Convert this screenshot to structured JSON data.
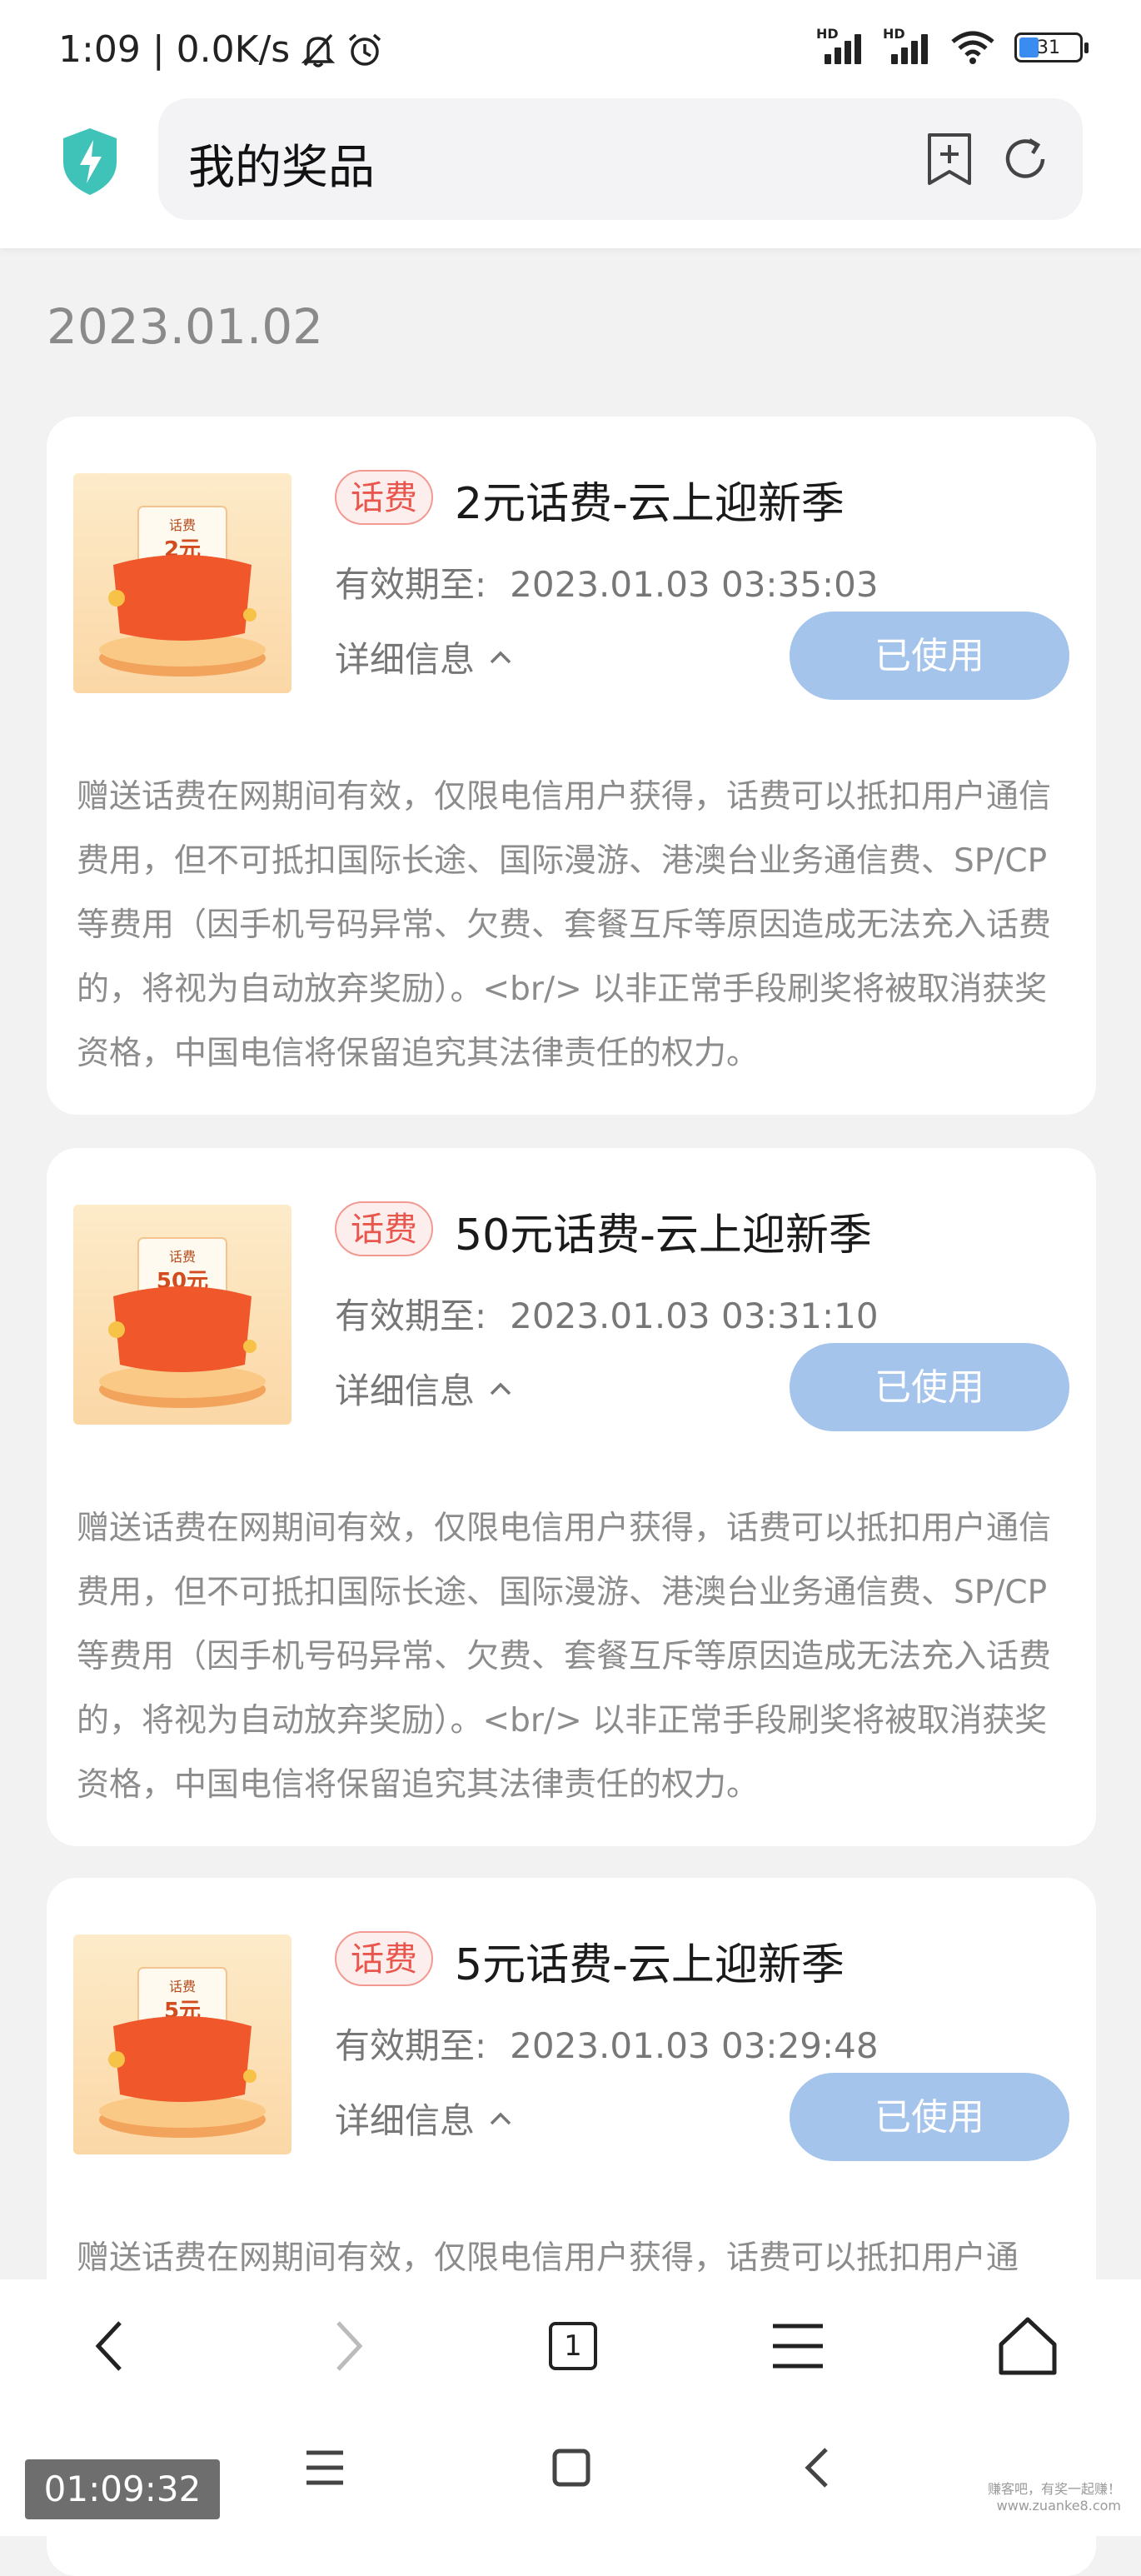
{
  "status_bar": {
    "time": "1:09",
    "net_speed": "0.0K/s",
    "sim_label": "HD",
    "battery": "31"
  },
  "browser": {
    "title": "我的奖品"
  },
  "date_group": "2023.01.02",
  "prizes": [
    {
      "tag": "话费",
      "name": "2元话费-云上迎新季",
      "expire_label": "有效期至:",
      "expire_value": "2023.01.03 03:35:03",
      "detail_label": "详细信息",
      "status": "已使用",
      "thumb_text": "话费",
      "thumb_amount": "2元",
      "description": "赠送话费在网期间有效，仅限电信用户获得，话费可以抵扣用户通信费用，但不可抵扣国际长途、国际漫游、港澳台业务通信费、SP/CP等费用（因手机号码异常、欠费、套餐互斥等原因造成无法充入话费的，将视为自动放弃奖励）。<br/> 以非正常手段刷奖将被取消获奖资格，中国电信将保留追究其法律责任的权力。"
    },
    {
      "tag": "话费",
      "name": "50元话费-云上迎新季",
      "expire_label": "有效期至:",
      "expire_value": "2023.01.03 03:31:10",
      "detail_label": "详细信息",
      "status": "已使用",
      "thumb_text": "话费",
      "thumb_amount": "50元",
      "description": "赠送话费在网期间有效，仅限电信用户获得，话费可以抵扣用户通信费用，但不可抵扣国际长途、国际漫游、港澳台业务通信费、SP/CP等费用（因手机号码异常、欠费、套餐互斥等原因造成无法充入话费的，将视为自动放弃奖励）。<br/> 以非正常手段刷奖将被取消获奖资格，中国电信将保留追究其法律责任的权力。"
    },
    {
      "tag": "话费",
      "name": "5元话费-云上迎新季",
      "expire_label": "有效期至:",
      "expire_value": "2023.01.03 03:29:48",
      "detail_label": "详细信息",
      "status": "已使用",
      "thumb_text": "话费",
      "thumb_amount": "5元",
      "description": "赠送话费在网期间有效，仅限电信用户获得，话费可以抵扣用户通"
    }
  ],
  "bottom_nav": {
    "tab_count": "1"
  },
  "video_timestamp": "01:09:32",
  "watermark": "赚客吧，有奖一起赚！\nwww.zuanke8.com",
  "colors": {
    "accent": "#3b8cf0",
    "used_button": "#a4c4ec",
    "tag_red": "#e9564d",
    "shield": "#3fc2b8"
  }
}
